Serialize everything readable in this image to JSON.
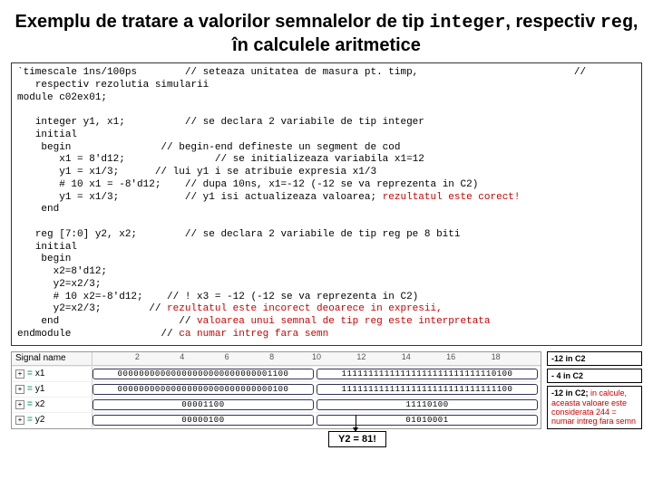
{
  "title_parts": {
    "t1": "Exemplu de tratare a valorilor semnalelor de tip ",
    "m1": "integer",
    "t2": ", respectiv ",
    "m2": "reg",
    "t3": ", în calculele aritmetice"
  },
  "code": {
    "l01a": "`timescale 1ns/100ps        // seteaza unitatea de masura pt. timp,                          //",
    "l01b": "   respectiv rezolutia simularii",
    "l02": "module c02ex01;",
    "l03": "",
    "l04": "   integer y1, x1;          // se declara 2 variabile de tip integer",
    "l05": "   initial",
    "l06": "    begin               // begin-end defineste un segment de cod",
    "l07": "       x1 = 8'd12;               // se initializeaza variabila x1=12",
    "l08": "       y1 = x1/3;      // lui y1 i se atribuie expresia x1/3",
    "l09": "       # 10 x1 = -8'd12;    // dupa 10ns, x1=-12 (-12 se va reprezenta in C2)",
    "l10a": "       y1 = x1/3;           // y1 isi actualizeaza valoarea; ",
    "l10b": "rezultatul este corect!",
    "l11": "    end",
    "l12": "",
    "l13": "   reg [7:0] y2, x2;        // se declara 2 variabile de tip reg pe 8 biti",
    "l14": "   initial",
    "l15": "    begin",
    "l16": "      x2=8'd12;",
    "l17": "      y2=x2/3;",
    "l18": "      # 10 x2=-8'd12;    // ! x3 = -12 (-12 se va reprezenta in C2)",
    "l19a": "      y2=x2/3;        // ",
    "l19b": "rezultatul este incorect deoarece in expresii,",
    "l20a": "    end                    // ",
    "l20b": "valoarea unui semnal de tip reg este interpretata",
    "l21a": "endmodule               // ",
    "l21b": "ca numar intreg fara semn"
  },
  "wave": {
    "header_label": "Signal name",
    "ticks": [
      "2",
      "4",
      "6",
      "8",
      "10",
      "12",
      "14",
      "16",
      "18"
    ],
    "rows": [
      {
        "name": "x1",
        "seg1": "00000000000000000000000000001100",
        "seg2": "11111111111111111111111111110100"
      },
      {
        "name": "y1",
        "seg1": "00000000000000000000000000000100",
        "seg2": "11111111111111111111111111111100"
      },
      {
        "name": "x2",
        "seg1": "00001100",
        "seg2": "11110100"
      },
      {
        "name": "y2",
        "seg1": "00000100",
        "seg2": "01010001"
      }
    ]
  },
  "notes": {
    "n1": "-12  in  C2",
    "n2": "- 4  in  C2",
    "n3a": "-12 in C2; ",
    "n3b": "in calcule, aceasta valoare este considerata 244 = numar intreg fara semn"
  },
  "callout": "Y2 = 81!"
}
